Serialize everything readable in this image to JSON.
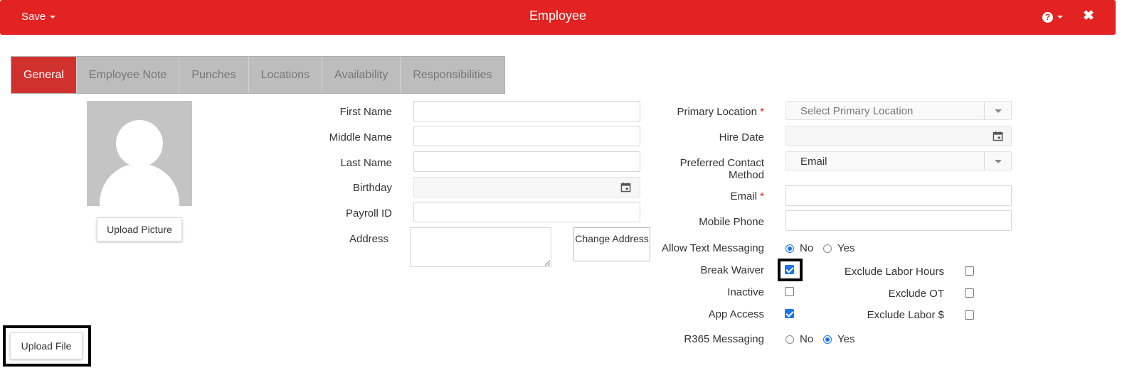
{
  "header": {
    "save_label": "Save",
    "title": "Employee",
    "help_icon": "question-circle-icon",
    "close_icon": "close-icon",
    "close_glyph": "✖",
    "help_glyph": "?"
  },
  "tabs": [
    {
      "label": "General",
      "active": true
    },
    {
      "label": "Employee Note",
      "active": false
    },
    {
      "label": "Punches",
      "active": false
    },
    {
      "label": "Locations",
      "active": false
    },
    {
      "label": "Availability",
      "active": false
    },
    {
      "label": "Responsibilities",
      "active": false
    }
  ],
  "avatar": {
    "upload_picture_label": "Upload Picture"
  },
  "upload_file_label": "Upload File",
  "personal": {
    "first_name_label": "First Name",
    "first_name_value": "",
    "middle_name_label": "Middle Name",
    "middle_name_value": "",
    "last_name_label": "Last Name",
    "last_name_value": "",
    "birthday_label": "Birthday",
    "birthday_value": "",
    "payroll_id_label": "Payroll ID",
    "payroll_id_value": "",
    "address_label": "Address",
    "address_value": "",
    "change_address_label": "Change Address"
  },
  "employment": {
    "primary_location_label": "Primary Location",
    "primary_location_placeholder": "Select Primary Location",
    "hire_date_label": "Hire Date",
    "hire_date_value": "",
    "preferred_contact_label": "Preferred Contact Method",
    "preferred_contact_value": "Email",
    "email_label": "Email",
    "email_value": "",
    "mobile_phone_label": "Mobile Phone",
    "mobile_phone_value": "",
    "required_mark": "*"
  },
  "options": {
    "allow_text_label": "Allow Text Messaging",
    "allow_text_value": "No",
    "no_label": "No",
    "yes_label": "Yes",
    "break_waiver_label": "Break Waiver",
    "break_waiver_checked": true,
    "inactive_label": "Inactive",
    "inactive_checked": false,
    "app_access_label": "App Access",
    "app_access_checked": true,
    "exclude_labor_hours_label": "Exclude Labor Hours",
    "exclude_labor_hours_checked": false,
    "exclude_ot_label": "Exclude OT",
    "exclude_ot_checked": false,
    "exclude_labor_dollars_label": "Exclude Labor $",
    "exclude_labor_dollars_checked": false,
    "r365_label": "R365 Messaging",
    "r365_value": "Yes"
  },
  "colors": {
    "header_bg": "#e32222",
    "active_tab": "#d0312d",
    "accent": "#1a73e8"
  }
}
